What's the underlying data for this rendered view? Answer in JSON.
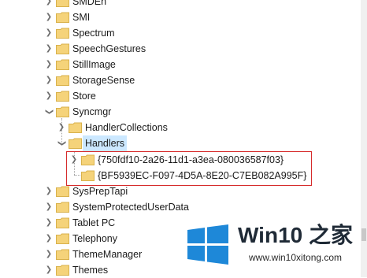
{
  "tree": {
    "items": [
      {
        "label": "SMDEn",
        "expander": "collapsed"
      },
      {
        "label": "SMI",
        "expander": "collapsed"
      },
      {
        "label": "Spectrum",
        "expander": "collapsed"
      },
      {
        "label": "SpeechGestures",
        "expander": "collapsed"
      },
      {
        "label": "StillImage",
        "expander": "collapsed"
      },
      {
        "label": "StorageSense",
        "expander": "collapsed"
      },
      {
        "label": "Store",
        "expander": "collapsed"
      },
      {
        "label": "Syncmgr",
        "expander": "expanded"
      },
      {
        "label": "HandlerCollections",
        "expander": "collapsed"
      },
      {
        "label": "Handlers",
        "expander": "expanded",
        "selected": true
      },
      {
        "label": "{750fdf10-2a26-11d1-a3ea-080036587f03}",
        "expander": "collapsed"
      },
      {
        "label": "{BF5939EC-F097-4D5A-8E20-C7EB082A995F}",
        "expander": "none"
      },
      {
        "label": "SysPrepTapi",
        "expander": "collapsed"
      },
      {
        "label": "SystemProtectedUserData",
        "expander": "collapsed"
      },
      {
        "label": "Tablet PC",
        "expander": "collapsed"
      },
      {
        "label": "Telephony",
        "expander": "collapsed"
      },
      {
        "label": "ThemeManager",
        "expander": "collapsed"
      },
      {
        "label": "Themes",
        "expander": "collapsed"
      }
    ]
  },
  "icons": {
    "folder": "folder-icon",
    "collapsed": "chevron-right-icon",
    "expanded": "chevron-down-icon"
  },
  "watermark": {
    "title": "Win10 之家",
    "url": "www.win10xitong.com"
  },
  "colors": {
    "folder_fill": "#f5d37a",
    "folder_edge": "#d9b24c",
    "selection": "#cce8ff",
    "highlight_box": "#d62c2c",
    "logo_blue": "#1e88d8"
  }
}
